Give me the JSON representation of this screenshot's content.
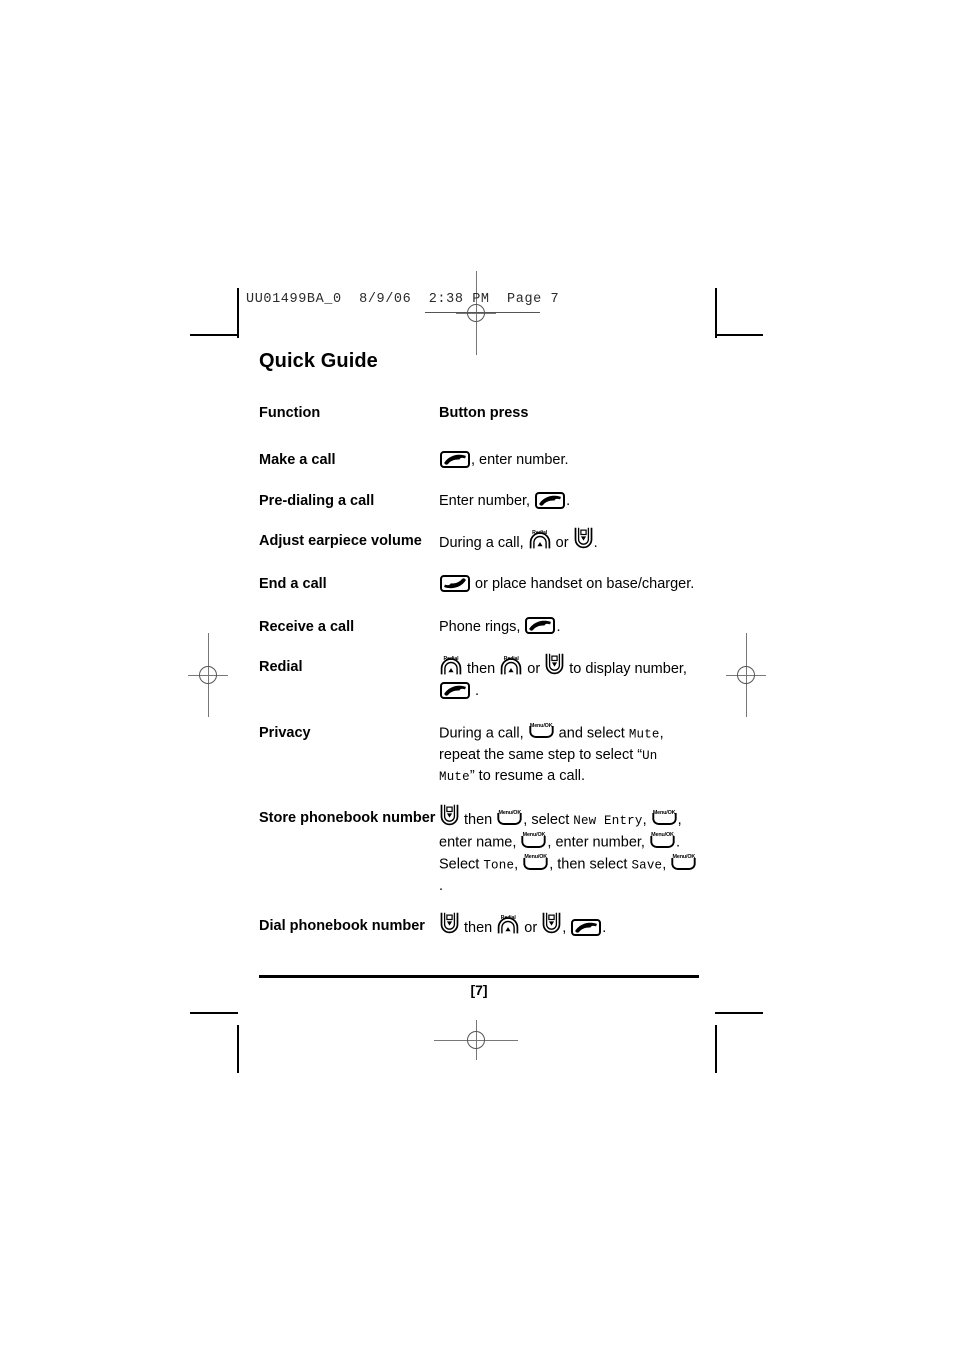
{
  "slug": {
    "text": "UU01499BA_0  8/9/06  2:38 PM  Page 7"
  },
  "page": {
    "title": "Quick Guide",
    "folio": "[7]"
  },
  "table": {
    "headers": {
      "function": "Function",
      "button_press": "Button press"
    },
    "rows": [
      {
        "function": "Make a call",
        "parts": [
          {
            "type": "key",
            "key": "talk"
          },
          {
            "type": "text",
            "text": ", enter number."
          }
        ]
      },
      {
        "function": "Pre-dialing a call",
        "parts": [
          {
            "type": "text",
            "text": "Enter number, "
          },
          {
            "type": "key",
            "key": "talk"
          },
          {
            "type": "text",
            "text": "."
          }
        ]
      },
      {
        "function": "Adjust earpiece volume",
        "parts": [
          {
            "type": "text",
            "text": "During a call, "
          },
          {
            "type": "key",
            "key": "up"
          },
          {
            "type": "text",
            "text": " or "
          },
          {
            "type": "key",
            "key": "down"
          },
          {
            "type": "text",
            "text": "."
          }
        ]
      },
      {
        "function": "End a call",
        "parts": [
          {
            "type": "key",
            "key": "end"
          },
          {
            "type": "text",
            "text": " or place handset on base/charger."
          }
        ]
      },
      {
        "function": "Receive a call",
        "parts": [
          {
            "type": "text",
            "text": "Phone rings, "
          },
          {
            "type": "key",
            "key": "talk"
          },
          {
            "type": "text",
            "text": "."
          }
        ]
      },
      {
        "function": "Redial",
        "parts": [
          {
            "type": "key",
            "key": "up"
          },
          {
            "type": "text",
            "text": " then "
          },
          {
            "type": "key",
            "key": "up"
          },
          {
            "type": "text",
            "text": " or "
          },
          {
            "type": "key",
            "key": "down"
          },
          {
            "type": "text",
            "text": " to display number, "
          },
          {
            "type": "key",
            "key": "talk"
          },
          {
            "type": "text",
            "text": " ."
          }
        ]
      },
      {
        "function": "Privacy",
        "parts": [
          {
            "type": "text",
            "text": "During a call, "
          },
          {
            "type": "key",
            "key": "menu"
          },
          {
            "type": "text",
            "text": " and select "
          },
          {
            "type": "screen",
            "text": "Mute"
          },
          {
            "type": "text",
            "text": ", repeat the same step to select “"
          },
          {
            "type": "screen",
            "text": "Un Mute"
          },
          {
            "type": "text",
            "text": "” to resume a call."
          }
        ]
      },
      {
        "function": "Store phonebook number",
        "parts": [
          {
            "type": "key",
            "key": "down"
          },
          {
            "type": "text",
            "text": " then "
          },
          {
            "type": "key",
            "key": "menu"
          },
          {
            "type": "text",
            "text": ", select "
          },
          {
            "type": "screen",
            "text": "New Entry"
          },
          {
            "type": "text",
            "text": ", "
          },
          {
            "type": "key",
            "key": "menu"
          },
          {
            "type": "text",
            "text": ", enter name, "
          },
          {
            "type": "key",
            "key": "menu"
          },
          {
            "type": "text",
            "text": ", enter number, "
          },
          {
            "type": "key",
            "key": "menu"
          },
          {
            "type": "text",
            "text": ". Select "
          },
          {
            "type": "screen",
            "text": "Tone"
          },
          {
            "type": "text",
            "text": ", "
          },
          {
            "type": "key",
            "key": "menu"
          },
          {
            "type": "text",
            "text": ", then select "
          },
          {
            "type": "screen",
            "text": "Save"
          },
          {
            "type": "text",
            "text": ", "
          },
          {
            "type": "key",
            "key": "menu"
          },
          {
            "type": "text",
            "text": " ."
          }
        ]
      },
      {
        "function": "Dial phonebook number",
        "parts": [
          {
            "type": "key",
            "key": "down"
          },
          {
            "type": "text",
            "text": " then "
          },
          {
            "type": "key",
            "key": "up"
          },
          {
            "type": "text",
            "text": " or "
          },
          {
            "type": "key",
            "key": "down"
          },
          {
            "type": "text",
            "text": ", "
          },
          {
            "type": "key",
            "key": "talk"
          },
          {
            "type": "text",
            "text": "."
          }
        ]
      }
    ]
  },
  "keys": {
    "talk": {
      "name": "talk-key-icon",
      "label": ""
    },
    "end": {
      "name": "end-call-key-icon",
      "label": ""
    },
    "up": {
      "name": "redial-up-key-icon",
      "label": "Redial"
    },
    "down": {
      "name": "down-key-icon",
      "label": ""
    },
    "menu": {
      "name": "menu-ok-key-icon",
      "label": "Menu/OK"
    }
  },
  "colors": {
    "text": "#000000",
    "slug": "#2a2a2a",
    "registration": "#777777"
  }
}
